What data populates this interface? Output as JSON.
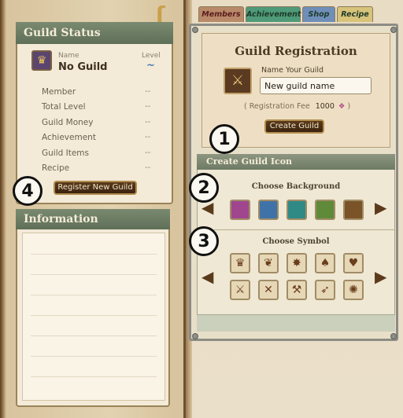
{
  "tabs": [
    {
      "label": "Members",
      "color": "#b98a6a"
    },
    {
      "label": "Achievement",
      "color": "#4f9a79"
    },
    {
      "label": "Shop",
      "color": "#6f8fb9"
    },
    {
      "label": "Recipe",
      "color": "#d7c37a"
    }
  ],
  "guild_status": {
    "title": "Guild Status",
    "name_label": "Name",
    "level_label": "Level",
    "guild_name": "No Guild",
    "level_value": "~",
    "rows": [
      {
        "label": "Member",
        "value": "--"
      },
      {
        "label": "Total Level",
        "value": "--"
      },
      {
        "label": "Guild Money",
        "value": "--"
      },
      {
        "label": "Achievement",
        "value": "--"
      },
      {
        "label": "Guild Items",
        "value": "--"
      },
      {
        "label": "Recipe",
        "value": "--"
      }
    ],
    "register_button": "Register New Guild"
  },
  "information": {
    "title": "Information"
  },
  "registration": {
    "title": "Guild Registration",
    "name_label": "Name Your Guild",
    "name_value": "New guild name",
    "fee_prefix": "( Registration Fee",
    "fee_amount": "1000",
    "fee_suffix": ")",
    "create_button": "Create Guild"
  },
  "icon_section": {
    "title": "Create Guild Icon",
    "background_label": "Choose Background",
    "symbol_label": "Choose Symbol",
    "background_colors": [
      "#a0468f",
      "#3f73a7",
      "#2f8a86",
      "#5e8a3a",
      "#7a5428"
    ]
  },
  "annotations": [
    "1",
    "2",
    "3",
    "4"
  ]
}
